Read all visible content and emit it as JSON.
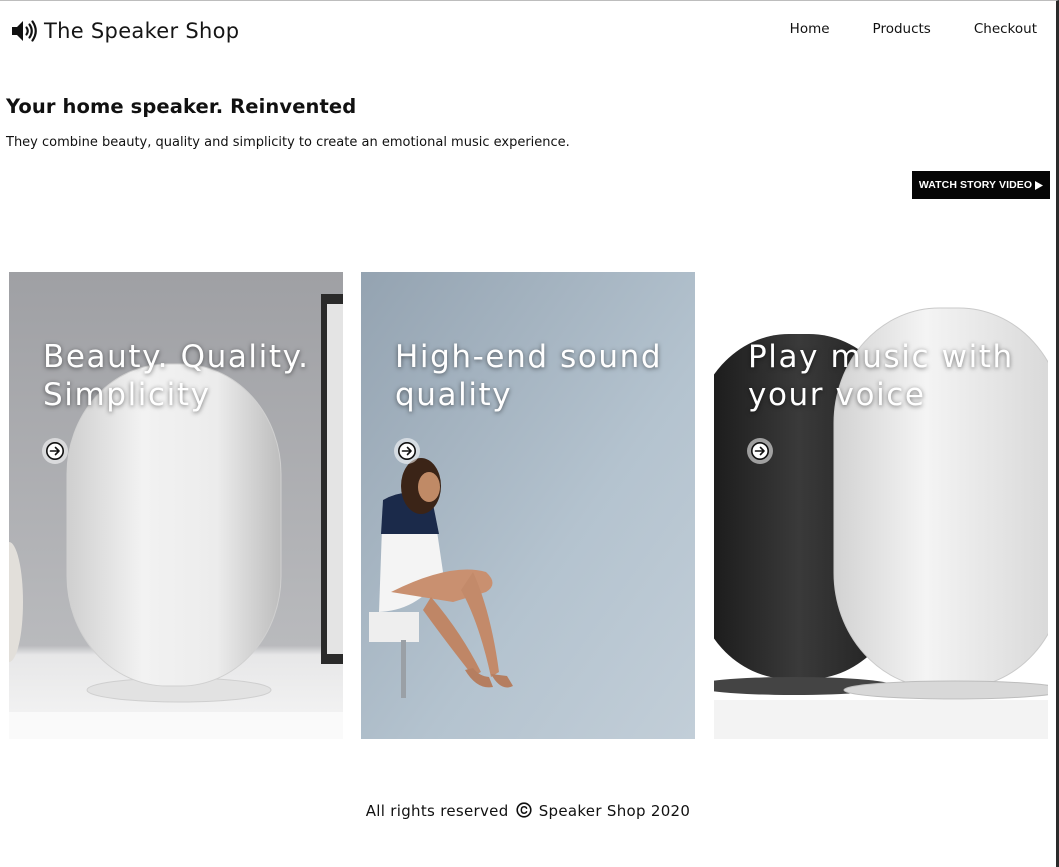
{
  "header": {
    "brand": "The Speaker Shop",
    "brand_icon": "speaker-volume-icon",
    "nav": [
      {
        "label": "Home"
      },
      {
        "label": "Products"
      },
      {
        "label": "Checkout"
      }
    ]
  },
  "hero": {
    "title": "Your home speaker. Reinvented",
    "subtitle": "They combine beauty, quality and simplicity to create an emotional music experience.",
    "cta_label": "WATCH STORY VIDEO",
    "cta_icon": "play-icon"
  },
  "cards": [
    {
      "title": "Beauty. Quality. Simplicity",
      "icon": "arrow-right-circle-icon"
    },
    {
      "title": "High-end sound quality",
      "icon": "arrow-right-circle-icon"
    },
    {
      "title": "Play music with your voice",
      "icon": "arrow-right-circle-icon"
    }
  ],
  "footer": {
    "text_before": "All rights reserved",
    "copyright_icon": "copyright-icon",
    "text_after": "Speaker Shop 2020"
  },
  "colors": {
    "background": "#ffffff",
    "text": "#111111",
    "button_bg": "#050505",
    "button_text": "#ffffff"
  }
}
